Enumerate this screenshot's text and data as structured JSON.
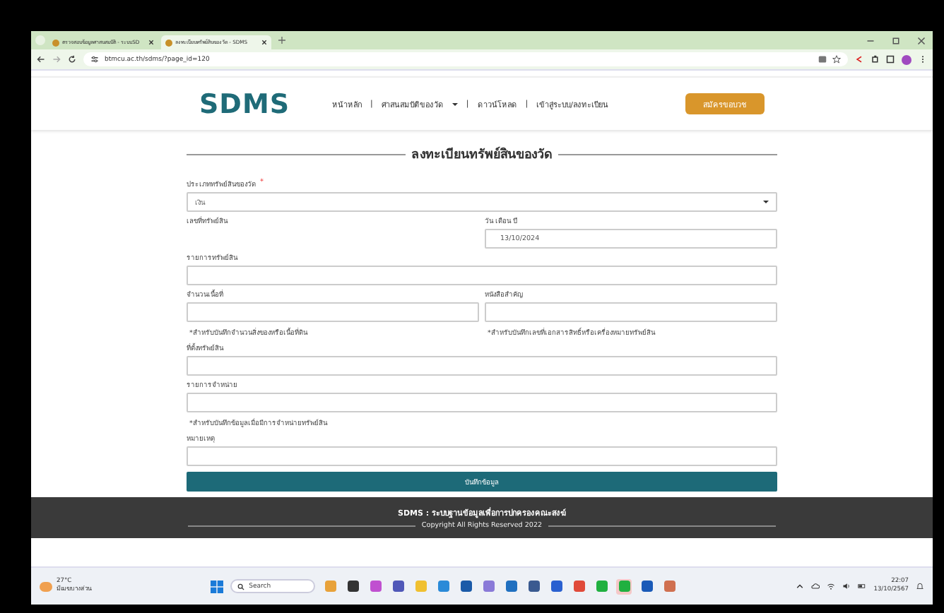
{
  "browser": {
    "tabs": [
      {
        "title": "ตรวจสอบข้อมูลศาสนสมบัติ - ระบบSD",
        "selected": false
      },
      {
        "title": "ลงทะเบียนทรัพย์สินของวัด - SDMS",
        "selected": true
      }
    ],
    "url": "btmcu.ac.th/sdms/?page_id=120"
  },
  "header": {
    "logo": "SDMS",
    "nav": [
      {
        "label": "หน้าหลัก",
        "dropdown": false
      },
      {
        "label": "ศาสนสมบัติของวัด",
        "dropdown": true
      },
      {
        "label": "ดาวน์โหลด",
        "dropdown": false
      },
      {
        "label": "เข้าสู่ระบบ/ลงทะเบียน",
        "dropdown": false
      }
    ],
    "nav_separator": "|",
    "cta": "สมัครขอบวช"
  },
  "form": {
    "title": "ลงทะเบียนทรัพย์สินของวัด",
    "rows": [
      {
        "kind": "select",
        "label": "ประเภททรัพย์สินของวัด",
        "required_mark": "*",
        "value": "เงิน"
      },
      {
        "kind": "row",
        "cells": [
          {
            "kind": "label",
            "label": "เลขที่ทรัพย์สิน"
          },
          {
            "kind": "input",
            "label": "วัน เดือน ปี",
            "value": "13/10/2024"
          }
        ]
      },
      {
        "kind": "row",
        "cells": [
          {
            "kind": "input",
            "label": "รายการทรัพย์สิน"
          }
        ]
      },
      {
        "kind": "row",
        "cells": [
          {
            "kind": "input",
            "label": "จำนวนเนื้อที่"
          },
          {
            "kind": "input",
            "label": "หนังสือสำคัญ"
          }
        ]
      },
      {
        "kind": "row",
        "cells": [
          {
            "kind": "note",
            "label": "*สำหรับบันทึกจำนวนสิ่งของหรือเนื้อที่ดิน"
          },
          {
            "kind": "note",
            "label": "*สำหรับบันทึกเลขที่เอกสารสิทธิ์หรือเครื่องหมายทรัพย์สิน"
          }
        ]
      },
      {
        "kind": "row",
        "cells": [
          {
            "kind": "input",
            "label": "ที่ตั้งทรัพย์สิน"
          }
        ]
      },
      {
        "kind": "row",
        "cells": [
          {
            "kind": "input",
            "label": "รายการจำหน่าย"
          }
        ]
      },
      {
        "kind": "row",
        "cells": [
          {
            "kind": "note",
            "label": "*สำหรับบันทึกข้อมูลเมื่อมีการจำหน่ายทรัพย์สิน"
          }
        ]
      },
      {
        "kind": "row",
        "cells": [
          {
            "kind": "input",
            "label": "หมายเหตุ"
          }
        ]
      }
    ],
    "submit": "บันทึกข้อมูล"
  },
  "footer": {
    "title": "SDMS : ระบบฐานข้อมูลเพื่อการปกครองคณะสงฆ์",
    "copyright": "Copyright All Rights Reserved 2022"
  },
  "taskbar": {
    "temperature": "27°C",
    "weather": "มีเมฆบางส่วน",
    "search": "Search",
    "apps": [
      {
        "color": "#e8a23a",
        "selected": false
      },
      {
        "color": "#333333",
        "selected": false
      },
      {
        "color": "#c050d0",
        "selected": false
      },
      {
        "color": "#5058b8",
        "selected": false
      },
      {
        "color": "#f0c030",
        "selected": false
      },
      {
        "color": "#2a8ad8",
        "selected": false
      },
      {
        "color": "#1a5aa8",
        "selected": false
      },
      {
        "color": "#8a7ad8",
        "selected": false
      },
      {
        "color": "#2070c0",
        "selected": false
      },
      {
        "color": "#3a5a90",
        "selected": false
      },
      {
        "color": "#2a60d0",
        "selected": false
      },
      {
        "color": "#e04a3a",
        "selected": false
      },
      {
        "color": "#20b040",
        "selected": false
      },
      {
        "color": "#20b040",
        "selected": true
      },
      {
        "color": "#1a5ab8",
        "selected": false
      },
      {
        "color": "#d07050",
        "selected": false
      }
    ],
    "time": "22:07",
    "date": "13/10/2567"
  }
}
